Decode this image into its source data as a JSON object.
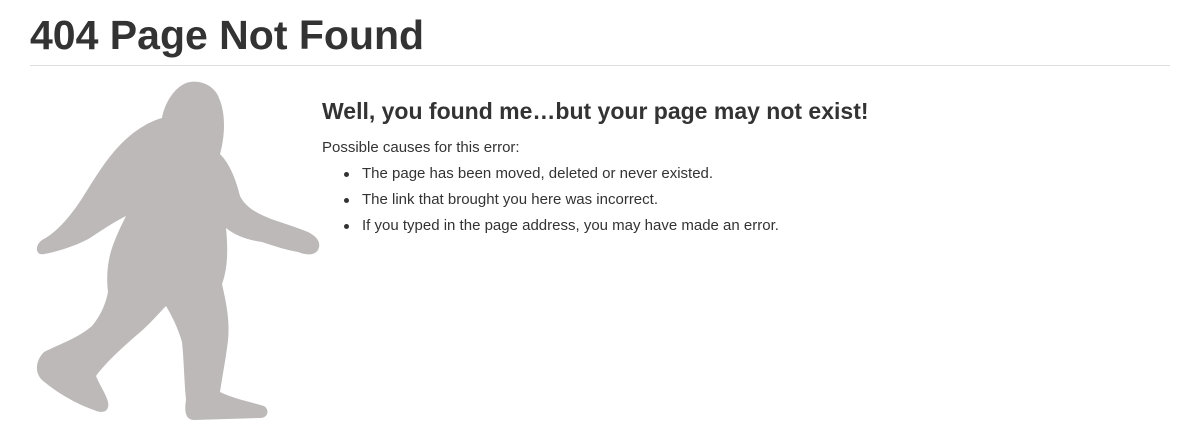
{
  "header": {
    "title": "404 Page Not Found"
  },
  "main": {
    "subtitle": "Well, you found me…but your page may not exist!",
    "causes_intro": "Possible causes for this error:",
    "causes": [
      "The page has been moved, deleted or never existed.",
      "The link that brought you here was incorrect.",
      "If you typed in the page address, you may have made an error."
    ],
    "illustration_icon": "bigfoot-icon"
  },
  "colors": {
    "text": "#333333",
    "rule": "#dedede",
    "illustration": "#bcb9b8"
  }
}
